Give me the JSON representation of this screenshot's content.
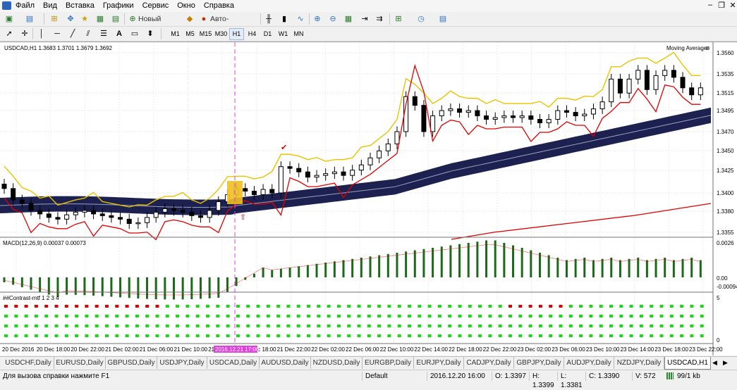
{
  "menu": [
    "Файл",
    "Вид",
    "Вставка",
    "Графики",
    "Сервис",
    "Окно",
    "Справка"
  ],
  "toolbar": {
    "new_order": "Новый ордер",
    "auto_trading": "Авто-торговля"
  },
  "timeframes": [
    "M1",
    "M5",
    "M15",
    "M30",
    "H1",
    "H4",
    "D1",
    "W1",
    "MN"
  ],
  "active_timeframe": "H1",
  "chart": {
    "title": "USDCAD,H1  1.3683 1.3701 1.3679 1.3692",
    "indicator_label": "Moving Average",
    "price_labels": [
      "1.3560",
      "1.3535",
      "1.3515",
      "1.3495",
      "1.3470",
      "1.3450",
      "1.3425",
      "1.3400",
      "1.3380",
      "1.3355"
    ],
    "macd_title": "MACD(12,26,9) 0.00037 0.00073",
    "macd_labels": [
      "0.0026",
      "0.00",
      "-0.00094"
    ],
    "contrast_title": "##Contrast-mtf 1 2 3 4",
    "contrast_labels": [
      "5",
      "0"
    ],
    "time_labels": [
      "20 Dec 2016",
      "20 Dec 18:00",
      "20 Dec 22:00",
      "21 Dec 02:00",
      "21 Dec 06:00",
      "21 Dec 10:00",
      "21",
      "21 Dec 18:00",
      "21 Dec 22:00",
      "22 Dec 02:00",
      "22 Dec 06:00",
      "22 Dec 10:00",
      "22 Dec 14:00",
      "22 Dec 18:00",
      "22 Dec 22:00",
      "23 Dec 02:00",
      "23 Dec 06:00",
      "23 Dec 10:00",
      "23 Dec 14:00",
      "23 Dec 18:00",
      "23 Dec 22:00"
    ],
    "cursor_time": "2016.12.21 17:00",
    "colors": {
      "band": "#1c2150",
      "upper": "#e8c400",
      "red": "#e00000",
      "macd": "#1a6a1a",
      "cursor": "#e040e0"
    }
  },
  "tabs": [
    "USDCHF,Daily",
    "EURUSD,Daily",
    "GBPUSD,Daily",
    "USDJPY,Daily",
    "USDCAD,Daily",
    "AUDUSD,Daily",
    "NZDUSD,Daily",
    "EURGBP,Daily",
    "EURJPY,Daily",
    "CADJPY,Daily",
    "GBPJPY,Daily",
    "AUDJPY,Daily",
    "NZDJPY,Daily",
    "USDCAD,H1"
  ],
  "active_tab": "USDCAD,H1",
  "status": {
    "help": "Для вызова справки нажмите F1",
    "profile": "Default",
    "datetime": "2016.12.20 16:00",
    "open": "O: 1.3397",
    "high": "H: 1.3399",
    "low": "L: 1.3381",
    "close": "C: 1.3390",
    "volume": "V: 572",
    "traffic": "99/1 kb"
  }
}
